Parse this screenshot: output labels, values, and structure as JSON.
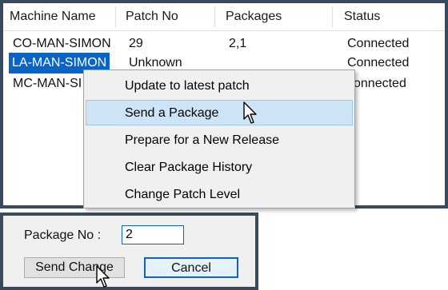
{
  "table": {
    "columns": [
      "Machine Name",
      "Patch No",
      "Packages",
      "Status"
    ],
    "rows": [
      {
        "machine": "CO-MAN-SIMON",
        "patch": "29",
        "packages": "2,1",
        "status": "Connected"
      },
      {
        "machine": "LA-MAN-SIMON",
        "patch": "Unknown",
        "packages": "",
        "status": "Connected"
      },
      {
        "machine": "MC-MAN-SI",
        "patch": "",
        "packages": "",
        "status": "onnected"
      }
    ]
  },
  "context_menu": {
    "items": [
      "Update to latest patch",
      "Send a Package",
      "Prepare for a New Release",
      "Clear Package History",
      "Change Patch Level"
    ],
    "hovered": "Send a Package"
  },
  "dialog": {
    "package_label": "Package No :",
    "package_value": "2",
    "send_button": "Send Change",
    "cancel_button": "Cancel"
  },
  "colors": {
    "selection": "#0a64c8",
    "menu_hover": "#cde4f7",
    "panel_border": "#3a4a5e"
  },
  "icons": [
    "arrow-cursor-icon"
  ]
}
